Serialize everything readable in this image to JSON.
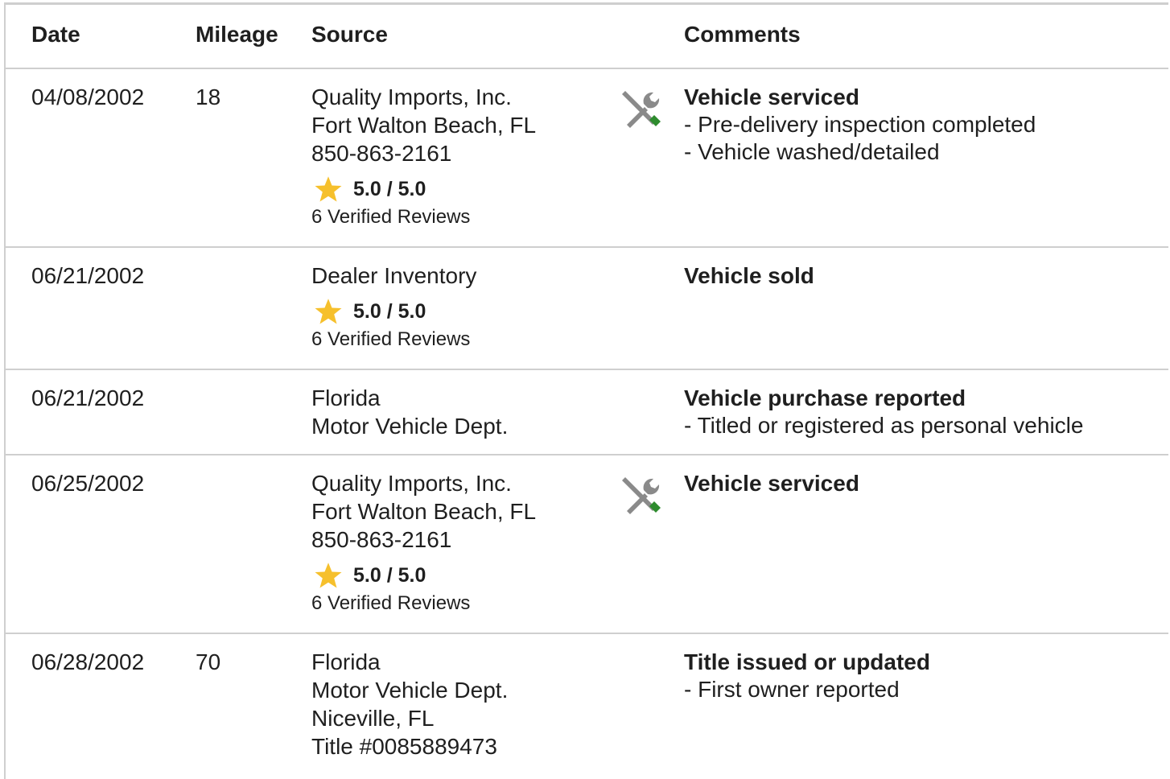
{
  "table": {
    "headers": {
      "date": "Date",
      "mileage": "Mileage",
      "source": "Source",
      "comments": "Comments"
    },
    "rows": [
      {
        "date": "04/08/2002",
        "mileage": "18",
        "source_lines": [
          "Quality Imports, Inc.",
          "Fort Walton Beach, FL",
          "850-863-2161"
        ],
        "rating": "5.0 / 5.0",
        "reviews": "6 Verified Reviews",
        "icon": "service-tools-icon",
        "comment_title": "Vehicle serviced",
        "comment_details": [
          "- Pre-delivery inspection completed",
          "- Vehicle washed/detailed"
        ]
      },
      {
        "date": "06/21/2002",
        "mileage": "",
        "source_lines": [
          "Dealer Inventory"
        ],
        "rating": "5.0 / 5.0",
        "reviews": "6 Verified Reviews",
        "icon": "",
        "comment_title": "Vehicle sold",
        "comment_details": []
      },
      {
        "date": "06/21/2002",
        "mileage": "",
        "source_lines": [
          "Florida",
          "Motor Vehicle Dept."
        ],
        "rating": "",
        "reviews": "",
        "icon": "",
        "comment_title": "Vehicle purchase reported",
        "comment_details": [
          "- Titled or registered as personal vehicle"
        ]
      },
      {
        "date": "06/25/2002",
        "mileage": "",
        "source_lines": [
          "Quality Imports, Inc.",
          "Fort Walton Beach, FL",
          "850-863-2161"
        ],
        "rating": "5.0 / 5.0",
        "reviews": "6 Verified Reviews",
        "icon": "service-tools-icon",
        "comment_title": "Vehicle serviced",
        "comment_details": []
      },
      {
        "date": "06/28/2002",
        "mileage": "70",
        "source_lines": [
          "Florida",
          "Motor Vehicle Dept.",
          "Niceville, FL",
          "Title #0085889473"
        ],
        "rating": "",
        "reviews": "",
        "icon": "",
        "comment_title": "Title issued or updated",
        "comment_details": [
          "- First owner reported"
        ]
      }
    ]
  },
  "colors": {
    "star": "#f6c02c",
    "tool_gray": "#8a8a8a",
    "tool_green": "#2e8b2e",
    "border": "#cfcfcf"
  }
}
